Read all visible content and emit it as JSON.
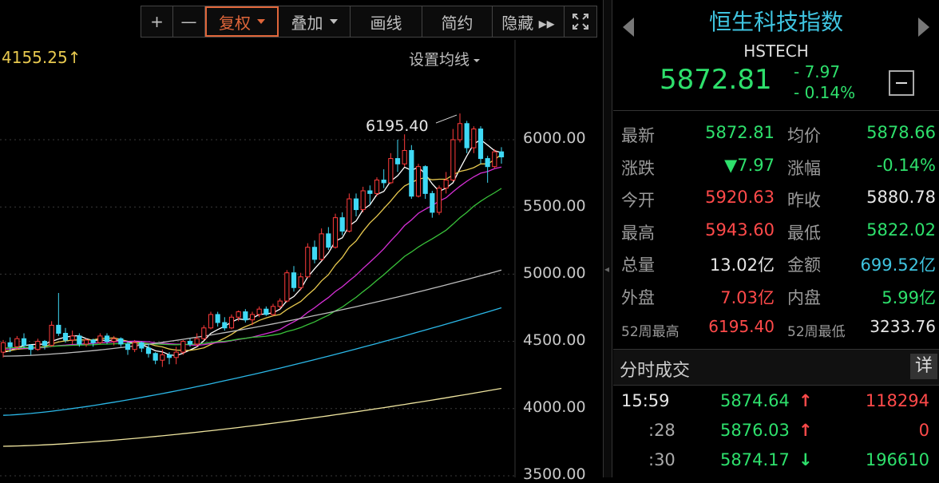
{
  "toolbar": {
    "plus_label": "+",
    "minus_label": "—",
    "fuquan_label": "复权",
    "diejia_label": "叠加",
    "huaxian_label": "画线",
    "jianyue_label": "简约",
    "yincang_label": "隐藏 ▸▸",
    "fullscreen_icon": "expand-icon"
  },
  "chart": {
    "low_marker": "4155.25↑",
    "high_marker": "6195.40",
    "ma_setting": "设置均线",
    "axis_labels": [
      "6000.00",
      "5500.00",
      "5000.00",
      "4500.00",
      "4000.00",
      "3500.00"
    ]
  },
  "chart_data": {
    "type": "candlestick",
    "y_axis": {
      "ticks": [
        6000,
        5500,
        5000,
        4500,
        4000,
        3500
      ],
      "range": [
        3480,
        6420
      ]
    },
    "high_label": 6195.4,
    "candles": [
      [
        4420,
        4490,
        4380,
        4510
      ],
      [
        4490,
        4460,
        4420,
        4530
      ],
      [
        4460,
        4520,
        4440,
        4540
      ],
      [
        4520,
        4470,
        4450,
        4560
      ],
      [
        4470,
        4440,
        4400,
        4480
      ],
      [
        4440,
        4500,
        4430,
        4520
      ],
      [
        4500,
        4470,
        4440,
        4510
      ],
      [
        4470,
        4620,
        4460,
        4650
      ],
      [
        4620,
        4560,
        4540,
        4860
      ],
      [
        4560,
        4510,
        4490,
        4600
      ],
      [
        4510,
        4540,
        4480,
        4580
      ],
      [
        4540,
        4480,
        4460,
        4560
      ],
      [
        4480,
        4510,
        4460,
        4520
      ],
      [
        4510,
        4490,
        4460,
        4520
      ],
      [
        4490,
        4540,
        4480,
        4560
      ],
      [
        4540,
        4500,
        4480,
        4560
      ],
      [
        4500,
        4520,
        4470,
        4540
      ],
      [
        4520,
        4480,
        4460,
        4530
      ],
      [
        4480,
        4440,
        4400,
        4500
      ],
      [
        4440,
        4490,
        4420,
        4510
      ],
      [
        4490,
        4450,
        4420,
        4500
      ],
      [
        4450,
        4410,
        4380,
        4480
      ],
      [
        4410,
        4360,
        4330,
        4420
      ],
      [
        4360,
        4400,
        4310,
        4440
      ],
      [
        4400,
        4380,
        4330,
        4420
      ],
      [
        4380,
        4420,
        4330,
        4460
      ],
      [
        4420,
        4500,
        4400,
        4510
      ],
      [
        4500,
        4480,
        4460,
        4520
      ],
      [
        4480,
        4520,
        4460,
        4560
      ],
      [
        4520,
        4600,
        4510,
        4620
      ],
      [
        4600,
        4700,
        4590,
        4720
      ],
      [
        4700,
        4640,
        4610,
        4720
      ],
      [
        4640,
        4600,
        4580,
        4680
      ],
      [
        4600,
        4680,
        4590,
        4700
      ],
      [
        4680,
        4720,
        4650,
        4730
      ],
      [
        4720,
        4660,
        4640,
        4740
      ],
      [
        4660,
        4700,
        4620,
        4720
      ],
      [
        4700,
        4740,
        4680,
        4760
      ],
      [
        4740,
        4700,
        4690,
        4760
      ],
      [
        4700,
        4760,
        4690,
        4780
      ],
      [
        4760,
        4800,
        4740,
        4820
      ],
      [
        4800,
        5010,
        4790,
        5030
      ],
      [
        5010,
        4900,
        4870,
        5060
      ],
      [
        4900,
        4980,
        4880,
        5010
      ],
      [
        4980,
        5200,
        4970,
        5230
      ],
      [
        5200,
        5110,
        5080,
        5250
      ],
      [
        5110,
        5300,
        5100,
        5340
      ],
      [
        5300,
        5200,
        5180,
        5350
      ],
      [
        5200,
        5420,
        5190,
        5450
      ],
      [
        5420,
        5320,
        5290,
        5460
      ],
      [
        5320,
        5560,
        5310,
        5600
      ],
      [
        5560,
        5480,
        5430,
        5600
      ],
      [
        5480,
        5620,
        5460,
        5650
      ],
      [
        5620,
        5600,
        5520,
        5660
      ],
      [
        5600,
        5700,
        5580,
        5720
      ],
      [
        5700,
        5680,
        5640,
        5780
      ],
      [
        5680,
        5860,
        5670,
        5900
      ],
      [
        5860,
        5820,
        5760,
        6000
      ],
      [
        5820,
        5920,
        5800,
        6040
      ],
      [
        5920,
        5580,
        5560,
        5960
      ],
      [
        5580,
        5800,
        5570,
        5820
      ],
      [
        5800,
        5600,
        5560,
        5810
      ],
      [
        5600,
        5460,
        5420,
        5620
      ],
      [
        5460,
        5640,
        5440,
        5660
      ],
      [
        5640,
        5700,
        5600,
        5760
      ],
      [
        5700,
        6000,
        5690,
        6080
      ],
      [
        6000,
        6120,
        5980,
        6195
      ],
      [
        6120,
        5940,
        5900,
        6140
      ],
      [
        5940,
        6080,
        5900,
        6100
      ],
      [
        6080,
        5860,
        5820,
        6100
      ],
      [
        5860,
        5800,
        5680,
        5880
      ],
      [
        5800,
        5910,
        5790,
        5930
      ],
      [
        5910,
        5872,
        5822,
        5944
      ]
    ],
    "ma_lines": [
      {
        "name": "MA5",
        "color": "#ffffff"
      },
      {
        "name": "MA10",
        "color": "#e8c94f"
      },
      {
        "name": "MA20",
        "color": "#d62fd6"
      },
      {
        "name": "MA30",
        "color": "#39c23a"
      },
      {
        "name": "MA60",
        "color": "#bdbdbd"
      },
      {
        "name": "MA120",
        "color": "#2bb8e8"
      },
      {
        "name": "MA250",
        "color": "#f0e6a0"
      }
    ]
  },
  "panel": {
    "title": "恒生科技指数",
    "code": "HSTECH",
    "price": "5872.81",
    "change": "- 7.97",
    "change_pct": "- 0.14%",
    "stats": [
      {
        "l1": "最新",
        "v1": "5872.81",
        "c1": "green",
        "l2": "均价",
        "v2": "5878.66",
        "c2": "green"
      },
      {
        "l1": "涨跌",
        "v1": "▼7.97",
        "c1": "green",
        "l2": "涨幅",
        "v2": "-0.14%",
        "c2": "green"
      },
      {
        "l1": "今开",
        "v1": "5920.63",
        "c1": "red",
        "l2": "昨收",
        "v2": "5880.78",
        "c2": "white"
      },
      {
        "l1": "最高",
        "v1": "5943.60",
        "c1": "red",
        "l2": "最低",
        "v2": "5822.02",
        "c2": "green"
      },
      {
        "l1": "总量",
        "v1": "13.02亿",
        "c1": "white",
        "l2": "金额",
        "v2": "699.52亿",
        "c2": "cyan"
      },
      {
        "l1": "外盘",
        "v1": "7.03亿",
        "c1": "red",
        "l2": "内盘",
        "v2": "5.99亿",
        "c2": "green"
      },
      {
        "l1": "52周最高",
        "v1": "6195.40",
        "c1": "red",
        "l2": "52周最低",
        "v2": "3233.76",
        "c2": "white"
      }
    ],
    "trades_title": "分时成交",
    "detail_label": "详",
    "trades": [
      {
        "time": "15:59",
        "price": "5874.64",
        "dir": "↑",
        "dircolor": "red",
        "vol": "118294",
        "volcolor": "red"
      },
      {
        "time": ":28",
        "price": "5876.03",
        "dir": "↑",
        "dircolor": "red",
        "vol": "0",
        "volcolor": "red"
      },
      {
        "time": ":30",
        "price": "5874.17",
        "dir": "↓",
        "dircolor": "green",
        "vol": "196610",
        "volcolor": "green"
      }
    ]
  }
}
